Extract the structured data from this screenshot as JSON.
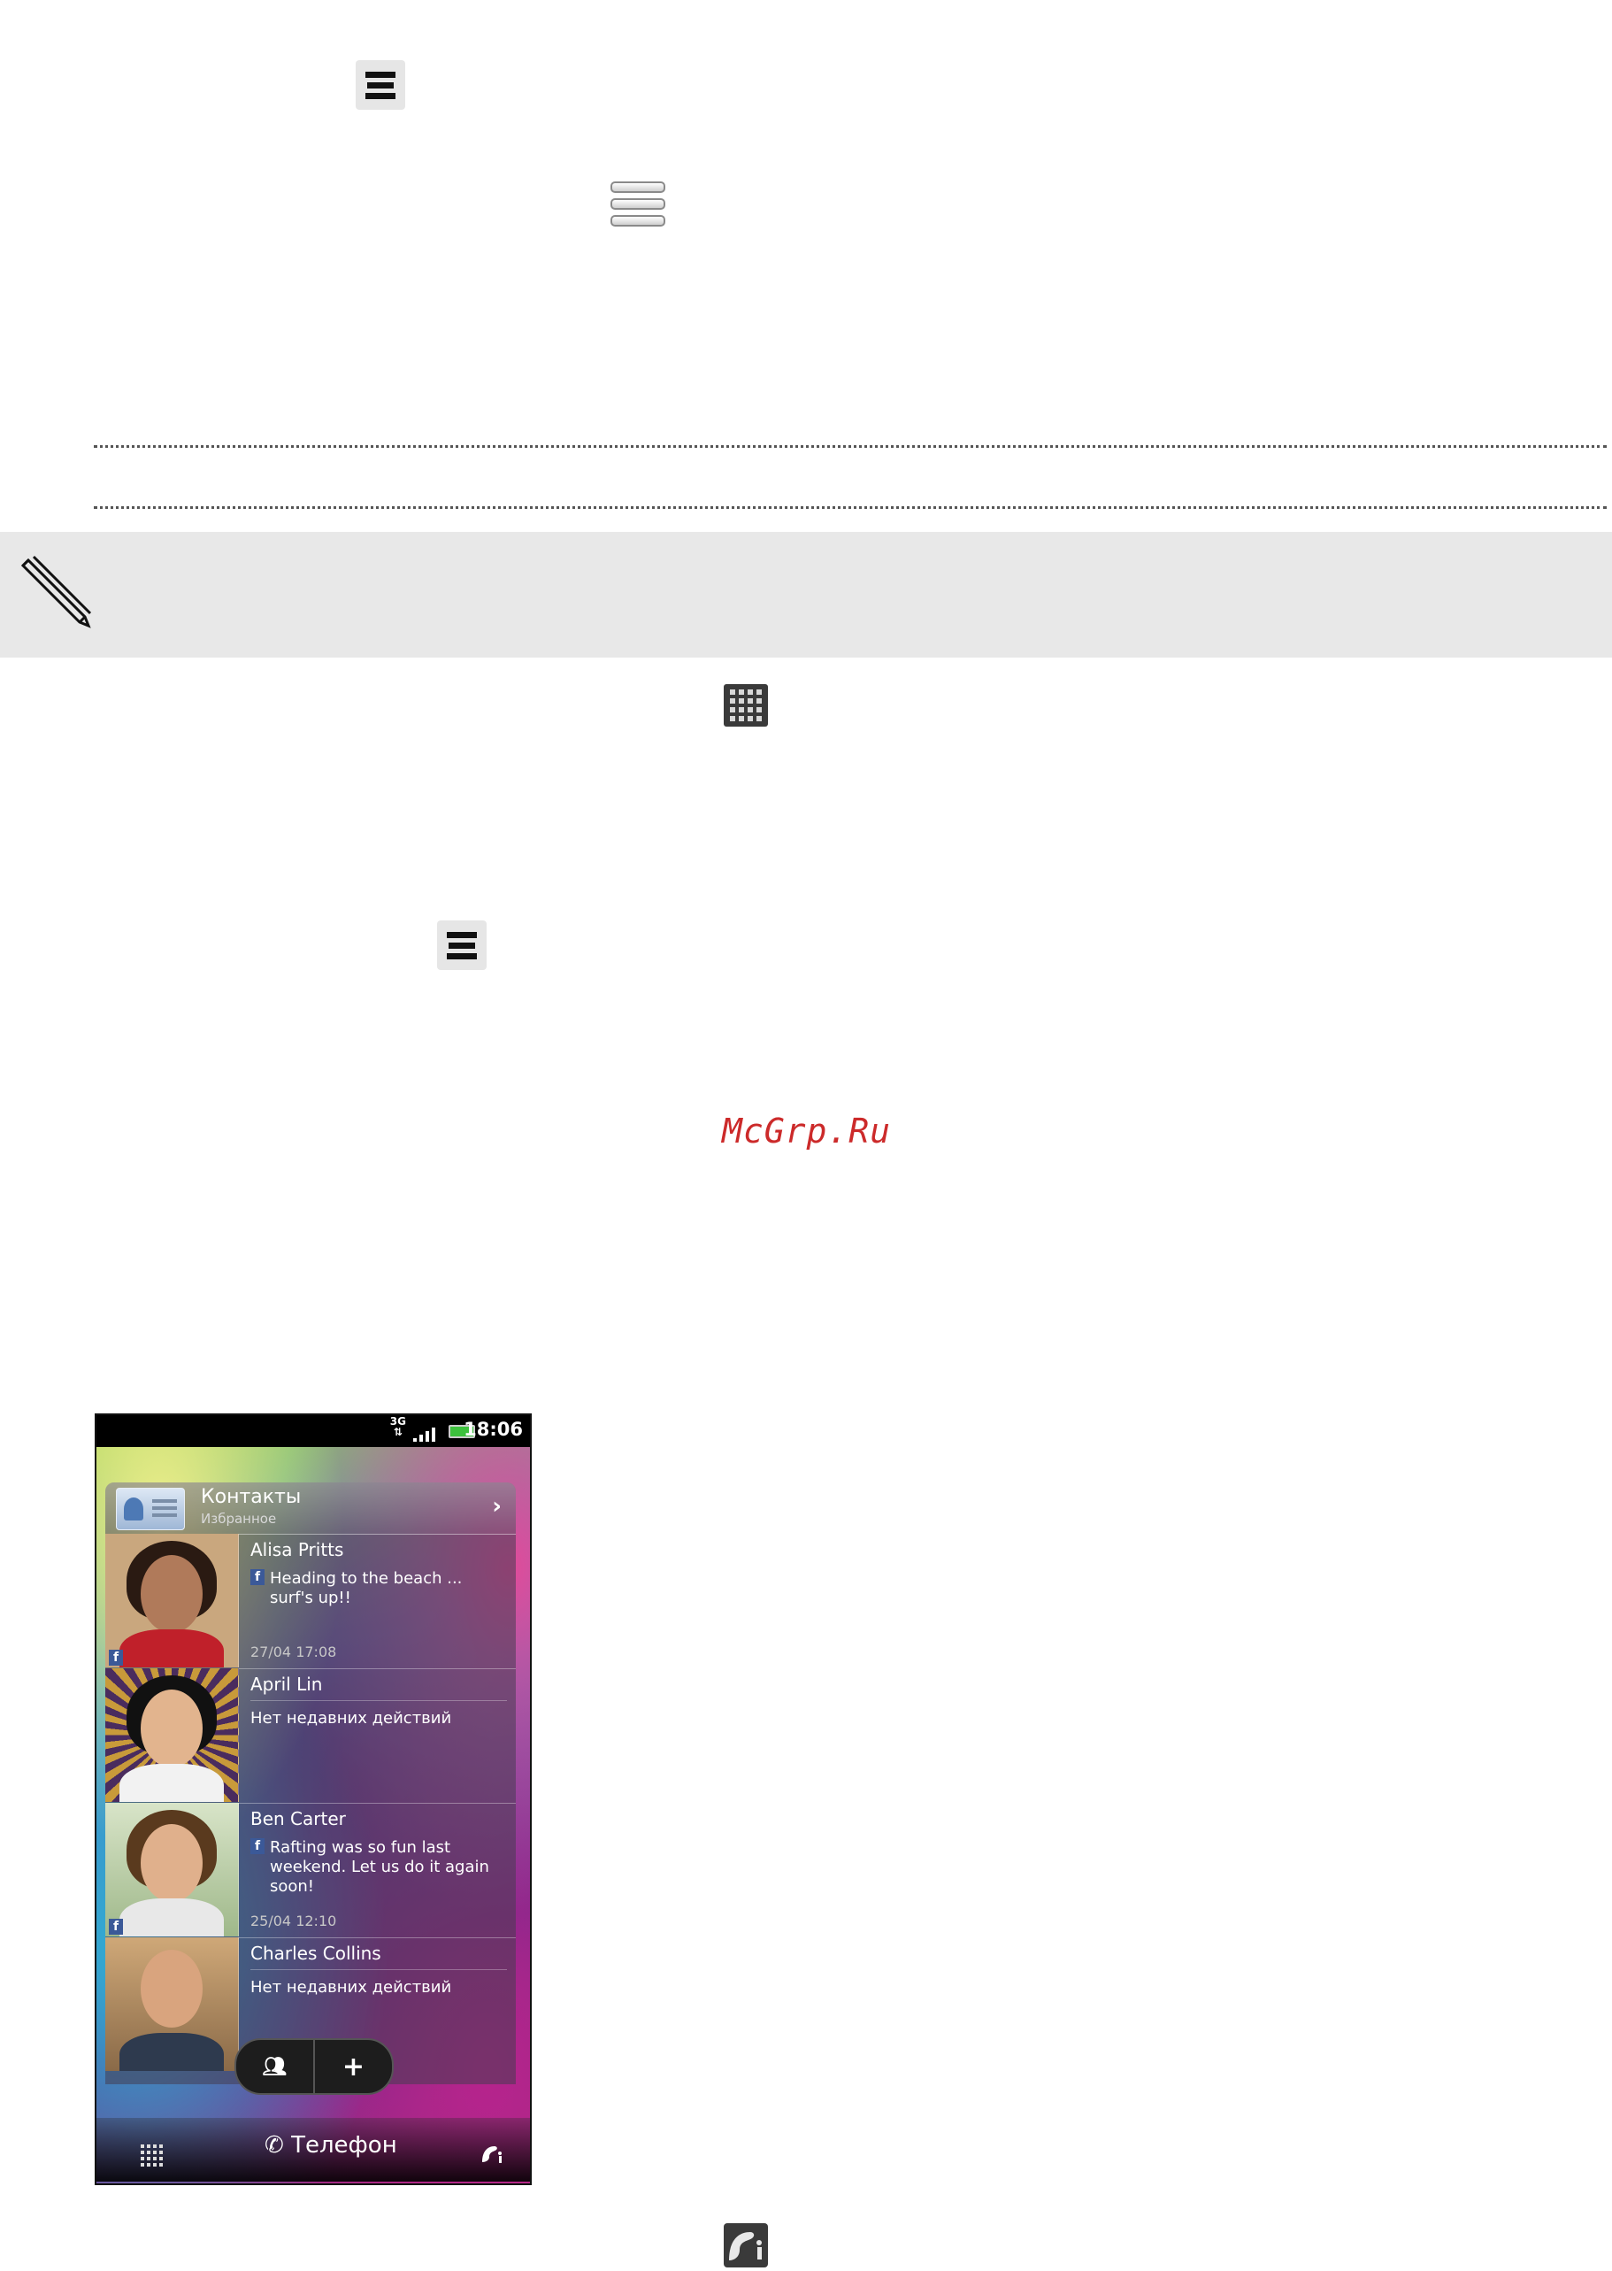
{
  "watermark": "McGrp.Ru",
  "phone": {
    "status": {
      "network": "3G",
      "time": "18:06"
    },
    "widget": {
      "title": "Контакты",
      "subtitle": "Избранное",
      "contacts": [
        {
          "name": "Alisa Pritts",
          "status": "Heading to the beach ... surf's up!!",
          "time": "27/04 17:08",
          "facebook": true
        },
        {
          "name": "April Lin",
          "status": "Нет недавних действий",
          "time": "",
          "facebook": false
        },
        {
          "name": "Ben Carter",
          "status": "Rafting was so fun last weekend. Let us do it again soon!",
          "time": "25/04 12:10",
          "facebook": true
        },
        {
          "name": "Charles Collins",
          "status": "Нет недавних действий",
          "time": "",
          "facebook": false
        }
      ]
    },
    "dock": {
      "phone_label": "Телефон"
    }
  },
  "icons": {
    "menu": "menu-icon",
    "list": "list-icon",
    "note": "pencil-icon",
    "apps": "all-apps-icon",
    "personalize": "personalize-icon"
  }
}
